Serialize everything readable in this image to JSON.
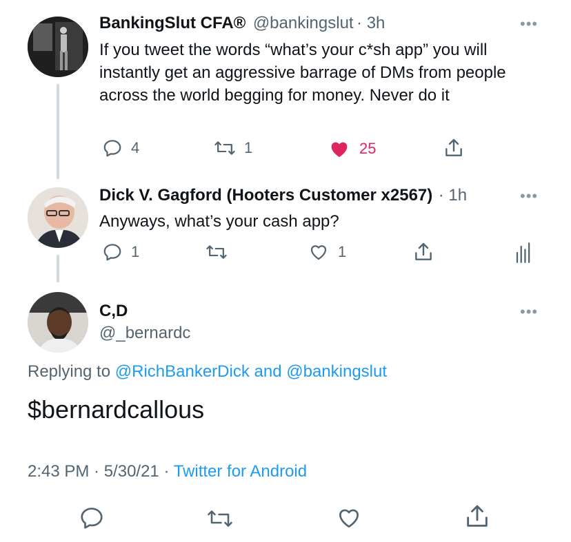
{
  "tweet1": {
    "name": "BankingSlut CFA®",
    "handle": "@bankingslut",
    "time": "· 3h",
    "text": "If you tweet the words “what’s your c*sh app” you will instantly get an aggressive barrage of DMs from people across the world begging for money. Never do it",
    "replies": "4",
    "retweets": "1",
    "likes": "25",
    "liked": true
  },
  "tweet2": {
    "name": "Dick V. Gagford (Hooters Customer x2567)",
    "time": "· 1h",
    "text": "Anyways, what’s your cash app?",
    "replies": "1",
    "retweets": "",
    "likes": "1"
  },
  "tweet3": {
    "name": "C,D",
    "handle": "@_bernardc",
    "replying_prefix": "Replying to",
    "reply_user1": "@RichBankerDick",
    "reply_and": "and",
    "reply_user2": "@bankingslut",
    "text": "$bernardcallous",
    "timestamp": "2:43 PM · 5/30/21 ·",
    "client": "Twitter for Android"
  },
  "colors": {
    "like_red": "#f91880",
    "link_blue": "#1d9bf0",
    "muted": "#536471"
  }
}
